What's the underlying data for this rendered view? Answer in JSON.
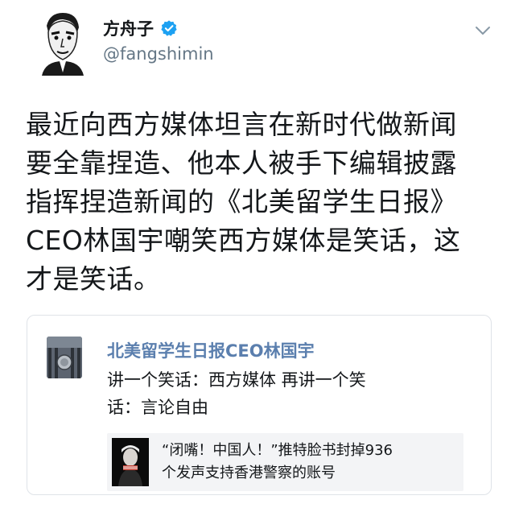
{
  "author": {
    "display_name": "方舟子",
    "handle": "@fangshimin",
    "verified": true
  },
  "tweet": {
    "lines": [
      "最近向西方媒体坦言在新时代做新闻",
      "要全靠捏造、他本人被手下编辑披露",
      "指挥捏造新闻的《北美留学生日报》",
      "CEO林国宇嘲笑西方媒体是笑话，这",
      "才是笑话。"
    ]
  },
  "quote": {
    "title": "北美留学生日报CEO林国宇",
    "body_lines": [
      "讲一个笑话：西方媒体  再讲一个笑",
      "话：言论自由"
    ],
    "link": {
      "lines": [
        "“闭嘴！中国人！”推特脸书封掉936",
        "个发声支持香港警察的账号"
      ]
    }
  },
  "icons": {
    "verified": "verified-badge-icon",
    "menu": "chevron-down-icon"
  },
  "colors": {
    "verified": "#1da1f2",
    "quote_title": "#5b7fae",
    "handle": "#657786"
  }
}
